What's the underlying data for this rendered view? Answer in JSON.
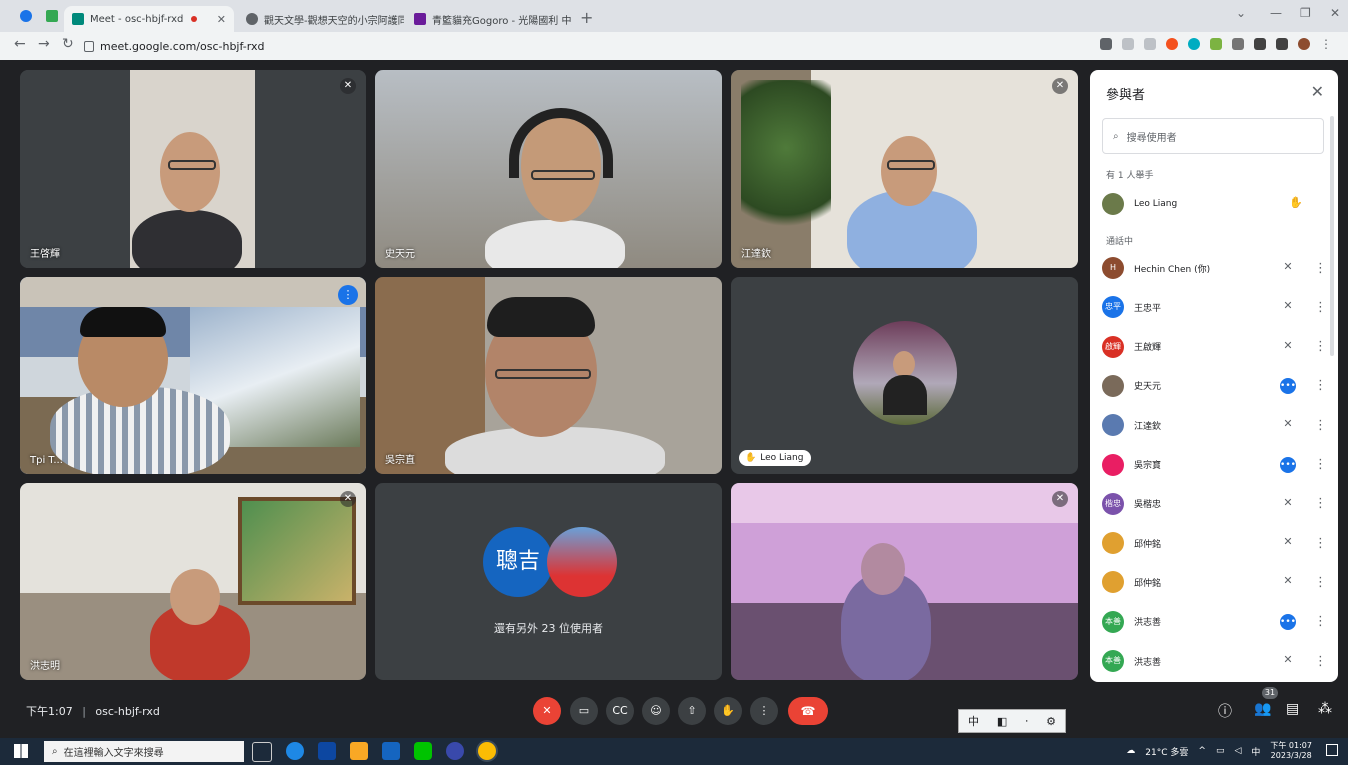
{
  "browser": {
    "tabs": [
      {
        "title": "Meet - osc-hbjf-rxd",
        "active": true
      },
      {
        "title": "觀天文學-觀想天空的小宗阿護同",
        "active": false
      },
      {
        "title": "青籃貓充Gogoro - 光陽國利 中文",
        "active": false
      }
    ],
    "url": "meet.google.com/osc-hbjf-rxd"
  },
  "tiles": [
    {
      "name": "王啓輝",
      "muted": true
    },
    {
      "name": "史天元",
      "muted": false
    },
    {
      "name": "江達欽",
      "muted": true
    },
    {
      "name": "Tpi T...",
      "speaking": true
    },
    {
      "name": "吳宗直",
      "muted": false
    },
    {
      "name": "Leo Liang"
    },
    {
      "name": "洪志明",
      "muted": true
    },
    {
      "others_label": "還有另外 23 位使用者",
      "avatar_text": "聰吉"
    },
    {
      "name": "",
      "muted": true
    }
  ],
  "panel": {
    "title": "參與者",
    "search_placeholder": "搜尋使用者",
    "raised_section": "有 1 人舉手",
    "raised": [
      {
        "name": "Leo Liang"
      }
    ],
    "call_section": "通話中",
    "participants": [
      {
        "name": "Hechin Chen (你)",
        "avatar": "H",
        "color": "#8d4c2f",
        "status": "muted"
      },
      {
        "name": "王忠平",
        "avatar": "忠平",
        "color": "#1a73e8",
        "status": "muted"
      },
      {
        "name": "王啟輝",
        "avatar": "啟輝",
        "color": "#d93025",
        "status": "muted"
      },
      {
        "name": "史天元",
        "avatar": "",
        "color": "#7a6a5a",
        "status": "speaking"
      },
      {
        "name": "江達欽",
        "avatar": "",
        "color": "#5a7ab0",
        "status": "muted"
      },
      {
        "name": "吳宗寶",
        "avatar": "",
        "color": "#e91e63",
        "status": "speaking"
      },
      {
        "name": "吳楷忠",
        "avatar": "楷忠",
        "color": "#7b52ab",
        "status": "muted"
      },
      {
        "name": "邱仲銘",
        "avatar": "",
        "color": "#e0a030",
        "status": "muted"
      },
      {
        "name": "邱仲銘",
        "avatar": "",
        "color": "#e0a030",
        "status": "muted"
      },
      {
        "name": "洪志善",
        "avatar": "本善",
        "color": "#34a853",
        "status": "speaking"
      },
      {
        "name": "洪志善",
        "avatar": "本善",
        "color": "#34a853",
        "status": "muted"
      }
    ]
  },
  "bottom": {
    "time": "下午1:07",
    "code": "osc-hbjf-rxd",
    "people_count": "31"
  },
  "ime": {
    "mode": "中"
  },
  "taskbar": {
    "search_placeholder": "在這裡輸入文字來搜尋",
    "weather": "21°C 多雲",
    "lang": "中",
    "time": "下午 01:07",
    "date": "2023/3/28"
  }
}
